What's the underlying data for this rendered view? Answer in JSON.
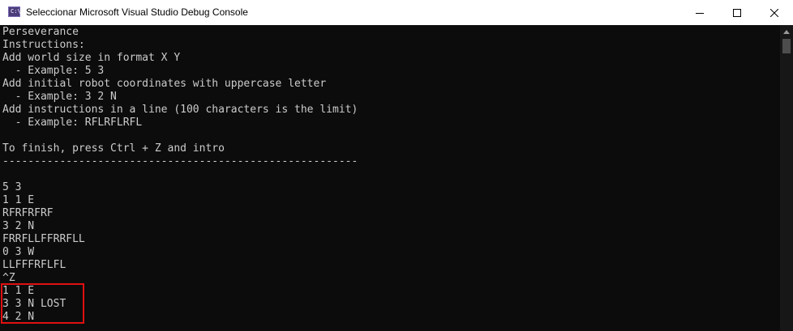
{
  "window": {
    "title": "Seleccionar Microsoft Visual Studio Debug Console",
    "icon": "console-app-icon",
    "icon_glyph": "C:\\",
    "controls": {
      "minimize_icon": "minimize-icon",
      "maximize_icon": "maximize-icon",
      "close_icon": "close-icon"
    }
  },
  "console": {
    "lines": [
      "Perseverance",
      "Instructions:",
      "Add world size in format X Y",
      "  - Example: 5 3",
      "Add initial robot coordinates with uppercase letter",
      "  - Example: 3 2 N",
      "Add instructions in a line (100 characters is the limit)",
      "  - Example: RFLRFLRFL",
      "",
      "To finish, press Ctrl + Z and intro",
      "--------------------------------------------------------",
      "",
      "5 3",
      "1 1 E",
      "RFRFRFRF",
      "3 2 N",
      "FRRFLLFFRRFLL",
      "0 3 W",
      "LLFFFRFLFL",
      "^Z",
      "1 1 E",
      "3 3 N LOST",
      "4 2 N"
    ]
  },
  "colors": {
    "console_background": "#0c0c0c",
    "console_text": "#cccccc",
    "titlebar_background": "#ffffff",
    "highlight_border": "#e01010"
  }
}
